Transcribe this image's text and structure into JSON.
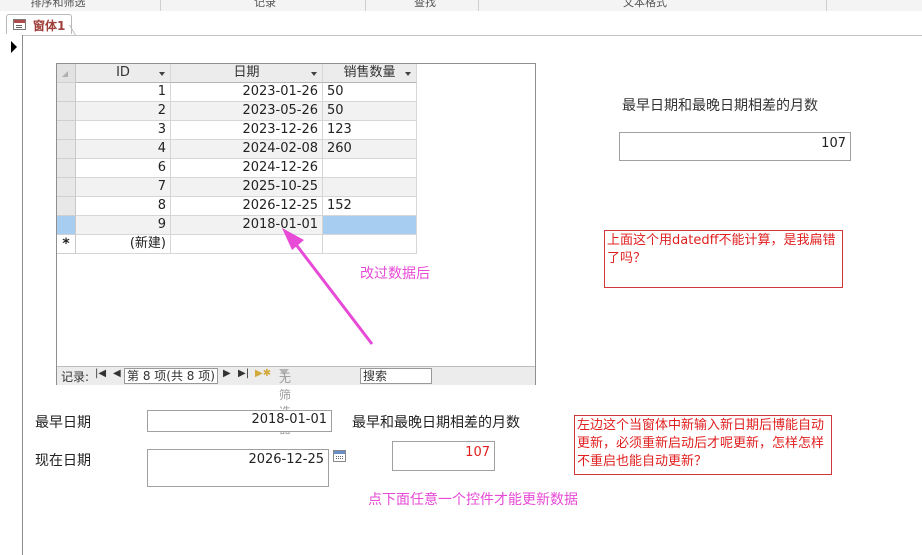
{
  "ribbon": {
    "groups": [
      "排序和筛选",
      "记录",
      "查找",
      "文本格式"
    ]
  },
  "tab": {
    "title": "窗体1"
  },
  "datasheet": {
    "columns": [
      "ID",
      "日期",
      "销售数量"
    ],
    "rows": [
      {
        "id": "1",
        "date": "2023-01-26",
        "qty": "50"
      },
      {
        "id": "2",
        "date": "2023-05-26",
        "qty": "50"
      },
      {
        "id": "3",
        "date": "2023-12-26",
        "qty": "123"
      },
      {
        "id": "4",
        "date": "2024-02-08",
        "qty": "260"
      },
      {
        "id": "6",
        "date": "2024-12-26",
        "qty": ""
      },
      {
        "id": "7",
        "date": "2025-10-25",
        "qty": ""
      },
      {
        "id": "8",
        "date": "2026-12-25",
        "qty": "152"
      },
      {
        "id": "9",
        "date": "2018-01-01",
        "qty": ""
      }
    ],
    "new_row_marker": "*",
    "new_row_label": "(新建)",
    "nav": {
      "label": "记录:",
      "current": "第 8 项(共 8 项)",
      "no_filter": "无筛选器",
      "search": "搜索"
    }
  },
  "right_panel": {
    "diff_label": "最早日期和最晚日期相差的月数",
    "diff_value": "107",
    "note1": "上面这个用datedff不能计算，是我扁错了吗？"
  },
  "bottom": {
    "earliest_label": "最早日期",
    "earliest_value": "2018-01-01",
    "now_label": "现在日期",
    "now_value": "2026-12-25",
    "diff_label": "最早和最晚日期相差的月数",
    "diff_value": "107",
    "note2": "左边这个当窗体中新输入新日期后博能自动更新，必须重新启动后才呢更新，怎样怎样不重启也能自动更新？"
  },
  "annotations": {
    "after_edit": "改过数据后",
    "click_hint": "点下面任意一个控件才能更新数据"
  },
  "colors": {
    "annotation_pink": "#e64ad6",
    "note_red": "#e02020",
    "selection_blue": "#a7cdf0"
  }
}
